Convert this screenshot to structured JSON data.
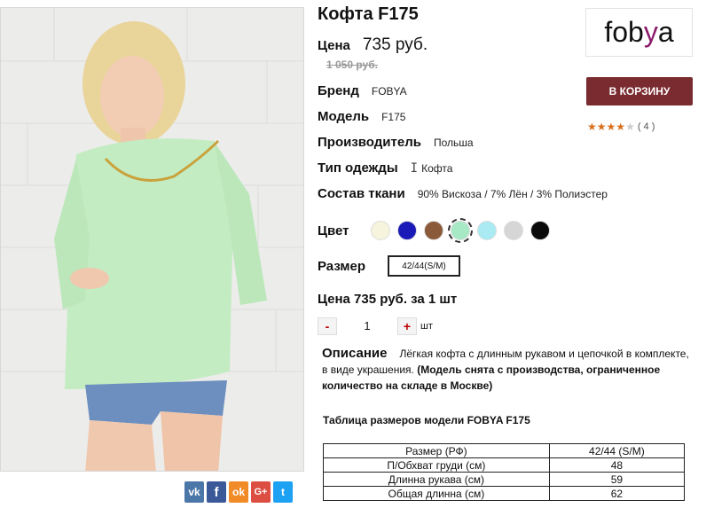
{
  "product": {
    "title": "Кофта F175",
    "price_label": "Цена",
    "price": "735 руб.",
    "old_price": "1 050 руб."
  },
  "properties": [
    {
      "label": "Бренд",
      "value": "FOBYA"
    },
    {
      "label": "Модель",
      "value": "F175"
    },
    {
      "label": "Производитель",
      "value": "Польша"
    },
    {
      "label": "Тип одежды",
      "value": "Кофта"
    },
    {
      "label": "Состав ткани",
      "value": "90% Вискоза / 7% Лён / 3% Полиэстер"
    }
  ],
  "color": {
    "label": "Цвет",
    "swatches": [
      "#f6f4dc",
      "#1a1ab8",
      "#8a5a3a",
      "#a7e8c5",
      "#a9eaf3",
      "#d6d6d6",
      "#0a0a0a"
    ],
    "selected_index": 3
  },
  "size": {
    "label": "Размер",
    "value": "42/44(S/M)"
  },
  "total": "Цена 735 руб. за 1 шт",
  "quantity": {
    "minus": "-",
    "value": "1",
    "plus": "+",
    "unit": "шт"
  },
  "description": {
    "label": "Описание",
    "text": "Лёгкая кофта с длинным рукавом и цепочкой в комплекте, в виде украшения.",
    "note": "(Модель снята с производства, ограниченное количество на складе в Москве)"
  },
  "size_table": {
    "title": "Таблица размеров модели FOBYA F175",
    "rows": [
      [
        "Размер (РФ)",
        "42/44 (S/M)"
      ],
      [
        "П/Обхват груди (см)",
        "48"
      ],
      [
        "Длинна рукава (см)",
        "59"
      ],
      [
        "Общая длинна (см)",
        "62"
      ]
    ]
  },
  "logo": {
    "text_a": "fob",
    "text_b": "y",
    "text_c": "a",
    "accent": "#8b1a6b"
  },
  "cart_button": "В КОРЗИНУ",
  "rating": {
    "stars": 3.5,
    "count": "( 4 )"
  },
  "share": [
    "vk-icon",
    "facebook-icon",
    "odnoklassniki-icon",
    "google-plus-icon",
    "twitter-icon"
  ],
  "colors": {
    "cart": "#7a2b30",
    "star": "#d96f1c"
  }
}
